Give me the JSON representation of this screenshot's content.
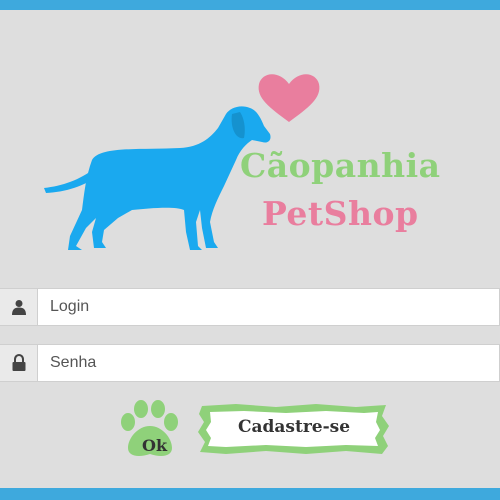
{
  "brand": {
    "line1": "Cãopanhia",
    "line2": "PetShop",
    "dog_color": "#1aa9ef",
    "heart_color": "#e97e9e",
    "green": "#8fd17a"
  },
  "form": {
    "login": {
      "placeholder": "Login",
      "value": "",
      "icon": "user-icon"
    },
    "password": {
      "placeholder": "Senha",
      "value": "",
      "icon": "lock-icon"
    }
  },
  "actions": {
    "ok_label": "Ok",
    "register_label": "Cadastre-se"
  },
  "colors": {
    "frame": "#3ea9dd",
    "panel": "#dedede"
  }
}
